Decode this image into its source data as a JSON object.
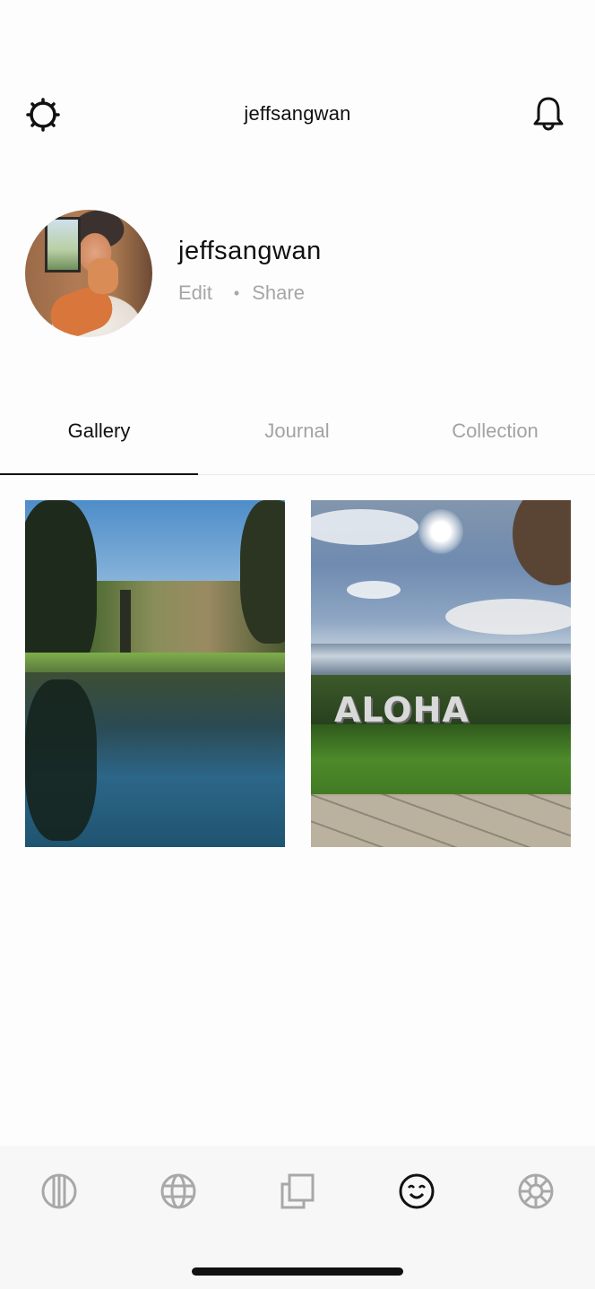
{
  "header": {
    "title": "jeffsangwan",
    "left_icon": "settings-gear-icon",
    "right_icon": "notification-bell-icon"
  },
  "profile": {
    "username": "jeffsangwan",
    "edit_label": "Edit",
    "separator": "•",
    "share_label": "Share",
    "avatar": "profile-photo"
  },
  "tabs": [
    {
      "label": "Gallery",
      "active": true
    },
    {
      "label": "Journal",
      "active": false
    },
    {
      "label": "Collection",
      "active": false
    }
  ],
  "gallery": [
    {
      "description": "Park pond with trees and reflection"
    },
    {
      "description": "ALOHA sign on lawn by the ocean",
      "sign_text": "ALOHA"
    }
  ],
  "bottom_nav": [
    {
      "icon": "striped-circle-icon",
      "active": false
    },
    {
      "icon": "globe-icon",
      "active": false
    },
    {
      "icon": "stacked-pages-icon",
      "active": false
    },
    {
      "icon": "smiley-face-icon",
      "active": true
    },
    {
      "icon": "wheel-icon",
      "active": false
    }
  ],
  "colors": {
    "text_primary": "#111111",
    "text_muted": "#a6a6a6",
    "icon_inactive": "#a8a8a8",
    "icon_active": "#111111",
    "bottom_bar_bg": "#f7f7f7"
  }
}
